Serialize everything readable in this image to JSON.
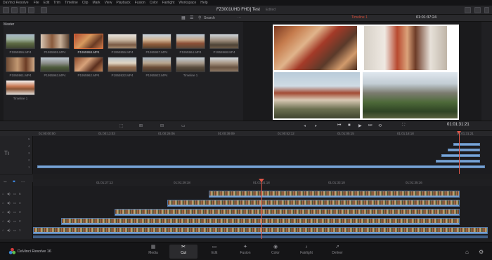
{
  "menu": {
    "app": "DaVinci Resolve",
    "items": [
      "File",
      "Edit",
      "Trim",
      "Timeline",
      "Clip",
      "Mark",
      "View",
      "Playback",
      "Fusion",
      "Color",
      "Fairlight",
      "Workspace",
      "Help"
    ]
  },
  "project": {
    "title": "FZ3001UHD FHD] Test",
    "status": "Edited"
  },
  "media_pool": {
    "search_label": "Search",
    "folder": "Master",
    "clips": [
      {
        "name": "P1955956.MP4",
        "selected": false
      },
      {
        "name": "P1955955.MP4",
        "selected": false
      },
      {
        "name": "P1955958.MP4",
        "selected": true
      },
      {
        "name": "P1955956.MP4",
        "selected": false
      },
      {
        "name": "P1955957.MP4",
        "selected": false
      },
      {
        "name": "P1955964.MP4",
        "selected": false
      },
      {
        "name": "P1955968.MP4",
        "selected": false
      },
      {
        "name": "P1955961.MP4",
        "selected": false
      },
      {
        "name": "P1955963.MP4",
        "selected": false
      },
      {
        "name": "P1955962.MP4",
        "selected": false
      },
      {
        "name": "P1955922.MP4",
        "selected": false
      },
      {
        "name": "P1955923.MP4",
        "selected": false
      },
      {
        "name": "Timeline 1",
        "selected": false
      }
    ]
  },
  "viewer": {
    "timeline_name": "Timeline 1",
    "timecode": "01:01:37:24",
    "transport_timecode": "01:01:31:21"
  },
  "upper_ruler": [
    "01:00:00:00",
    "01:00:13:03",
    "01:00:26:06",
    "01:00:39:09",
    "01:00:52:12",
    "01:01:05:15",
    "01:01:18:18",
    "01:01:31:21"
  ],
  "lower_ruler": [
    "01:01:27:12",
    "01:01:29:18",
    "01:01:31:18",
    "01:01:33:18",
    "01:01:35:16"
  ],
  "tracks": [
    "5",
    "4",
    "3",
    "2",
    "1"
  ],
  "pages": [
    {
      "label": "Media",
      "icon": "▦"
    },
    {
      "label": "Cut",
      "icon": "✂"
    },
    {
      "label": "Edit",
      "icon": "▭"
    },
    {
      "label": "Fusion",
      "icon": "✦"
    },
    {
      "label": "Color",
      "icon": "◉"
    },
    {
      "label": "Fairlight",
      "icon": "♪"
    },
    {
      "label": "Deliver",
      "icon": "➚"
    }
  ],
  "active_page": "Cut",
  "app_version": "DaVinci Resolve 16",
  "colors": {
    "accent": "#e05648",
    "clip_blue": "#79a4d4",
    "selected_clip": "#e06d3a"
  }
}
